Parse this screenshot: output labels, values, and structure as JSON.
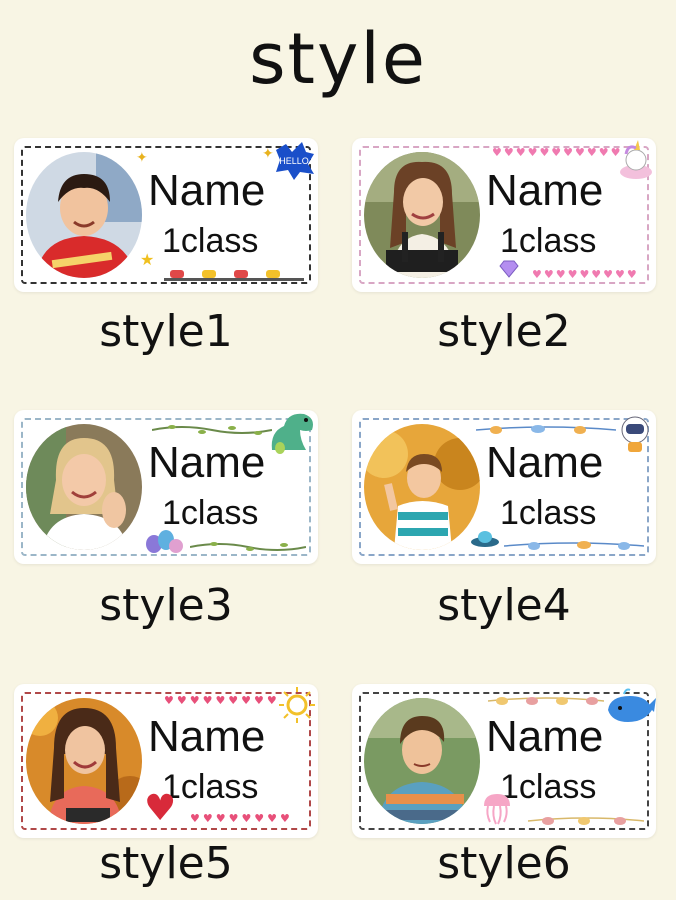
{
  "title": "style",
  "cards": [
    {
      "name": "Name",
      "cls": "1class",
      "label": "style1",
      "hello": "HELLO"
    },
    {
      "name": "Name",
      "cls": "1class",
      "label": "style2"
    },
    {
      "name": "Name",
      "cls": "1class",
      "label": "style3"
    },
    {
      "name": "Name",
      "cls": "1class",
      "label": "style4"
    },
    {
      "name": "Name",
      "cls": "1class",
      "label": "style5"
    },
    {
      "name": "Name",
      "cls": "1class",
      "label": "style6"
    }
  ],
  "colors": {
    "background": "#f8f5e4",
    "card": "#ffffff",
    "text": "#111111",
    "style1_border": "#333333",
    "style2_border": "#d8a6c4",
    "style3_border": "#9bb6c8",
    "style4_border": "#8aa6c8",
    "style5_border": "#b04848",
    "style6_border": "#444444"
  }
}
